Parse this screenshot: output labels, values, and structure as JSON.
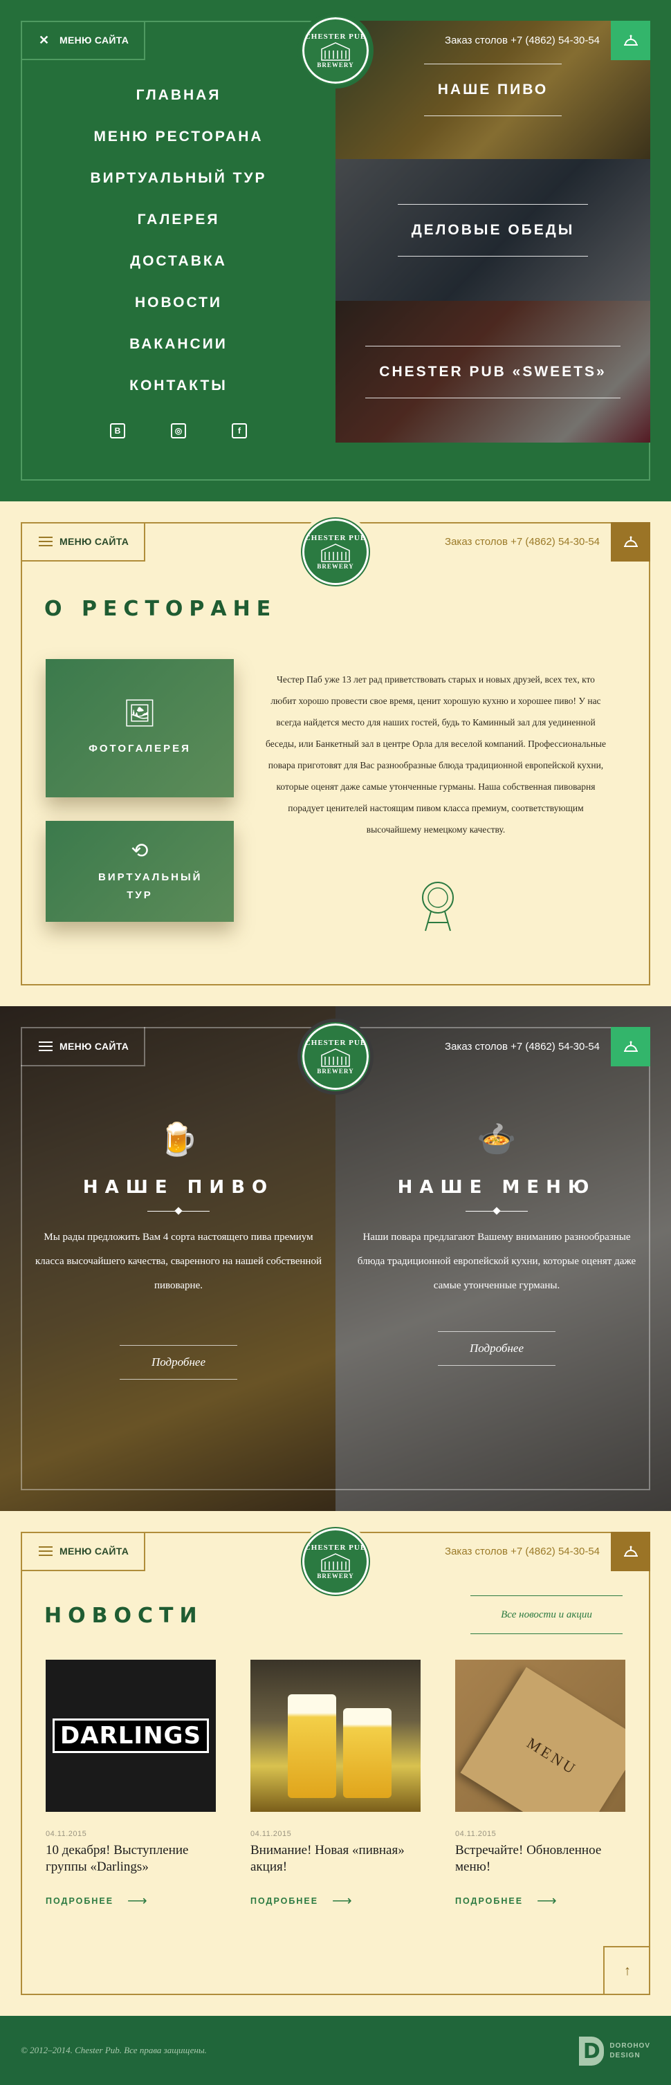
{
  "header": {
    "menu_label": "МЕНЮ САЙТА",
    "phone": "Заказ столов +7 (4862) 54-30-54",
    "logo_top": "CHESTER PUB",
    "logo_bottom": "BREWERY"
  },
  "nav": {
    "items": [
      "ГЛАВНАЯ",
      "МЕНЮ РЕСТОРАНА",
      "ВИРТУАЛЬНЫЙ ТУР",
      "ГАЛЕРЕЯ",
      "ДОСТАВКА",
      "НОВОСТИ",
      "ВАКАНСИИ",
      "КОНТАКТЫ"
    ],
    "social": [
      "В",
      "◎",
      "f"
    ]
  },
  "tiles": [
    "НАШЕ ПИВО",
    "ДЕЛОВЫЕ ОБЕДЫ",
    "CHESTER PUB «SWEETS»"
  ],
  "about": {
    "title": "О РЕСТОРАНЕ",
    "gallery_label": "ФОТОГАЛЕРЕЯ",
    "tour_label": "ВИРТУАЛЬНЫЙ ТУР",
    "text": "Честер Паб уже 13 лет рад приветствовать старых и новых друзей, всех тех, кто любит хорошо провести свое время, ценит хорошую кухню и хорошее пиво! У нас всегда найдется место для наших гостей, будь то Каминный зал для уединенной беседы, или Банкетный зал в центре Орла для веселой компаний. Профессиональные повара приготовят для Вас разнообразные блюда традиционной европейской кухни, которые оценят даже самые утонченные гурманы. Наша собственная пивоварня порадует ценителей настоящим пивом класса премиум, соответствующим высочайшему немецкому качеству."
  },
  "features": {
    "beer": {
      "title": "НАШЕ ПИВО",
      "text": "Мы рады предложить Вам 4 сорта настоящего пива премиум класса высочайшего качества, сваренного на нашей собственной пивоварне.",
      "more": "Подробнее"
    },
    "menu": {
      "title": "НАШЕ МЕНЮ",
      "text": "Наши повара предлагают Вашему вниманию разнообразные блюда традиционной европейской кухни, которые оценят даже самые утонченные гурманы.",
      "more": "Подробнее"
    }
  },
  "news": {
    "title": "НОВОСТИ",
    "all_link": "Все новости и акции",
    "more_label": "ПОДРОБНЕЕ",
    "items": [
      {
        "date": "04.11.2015",
        "title": "10 декабря! Выступление группы «Darlings»",
        "image_text": "DARLINGS"
      },
      {
        "date": "04.11.2015",
        "title": "Внимание! Новая «пивная» акция!"
      },
      {
        "date": "04.11.2015",
        "title": "Встречайте! Обновленное меню!",
        "image_text": "MENU"
      }
    ]
  },
  "footer": {
    "copyright": "© 2012–2014. Chester Pub. Все права защищены.",
    "dev_line1": "DOROHOV",
    "dev_line2": "DESIGN"
  },
  "colors": {
    "green": "#256f3a",
    "accent_green": "#33b56b",
    "cream": "#fbf1cd",
    "gold": "#9b7426"
  }
}
